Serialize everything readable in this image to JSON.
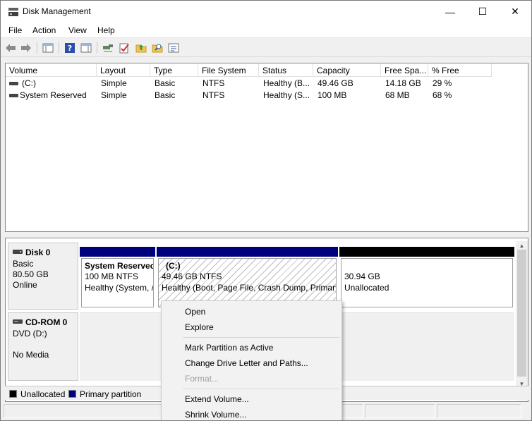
{
  "window": {
    "title": "Disk Management"
  },
  "controls": {
    "minimize": "—",
    "maximize": "☐",
    "close": "✕"
  },
  "menu": [
    "File",
    "Action",
    "View",
    "Help"
  ],
  "volume_list": {
    "columns": [
      "Volume",
      "Layout",
      "Type",
      "File System",
      "Status",
      "Capacity",
      "Free Spa...",
      "% Free"
    ],
    "rows": [
      [
        "(C:)",
        "Simple",
        "Basic",
        "NTFS",
        "Healthy (B...",
        "49.46 GB",
        "14.18 GB",
        "29 %"
      ],
      [
        "System Reserved",
        "Simple",
        "Basic",
        "NTFS",
        "Healthy (S...",
        "100 MB",
        "68 MB",
        "68 %"
      ]
    ]
  },
  "disks": [
    {
      "name": "Disk 0",
      "lines": [
        "Basic",
        "80.50 GB",
        "Online"
      ],
      "partitions": [
        {
          "title": "System Reservec",
          "line1": "100 MB NTFS",
          "line2": "Healthy (System, /"
        },
        {
          "title": "(C:)",
          "line1": "49.46 GB NTFS",
          "line2": "Healthy (Boot, Page File, Crash Dump, Primary"
        },
        {
          "title": "",
          "line1": "30.94 GB",
          "line2": "Unallocated"
        }
      ]
    },
    {
      "name": "CD-ROM 0",
      "lines": [
        "DVD (D:)",
        "",
        "No Media"
      ]
    }
  ],
  "legend": [
    {
      "label": "Unallocated",
      "color": "#000000"
    },
    {
      "label": "Primary partition",
      "color": "#00007f"
    }
  ],
  "colors": {
    "primary_bar": "#00007f",
    "unallocated_bar": "#000000"
  },
  "context_menu": {
    "open": "Open",
    "explore": "Explore",
    "mark_active": "Mark Partition as Active",
    "change_letter": "Change Drive Letter and Paths...",
    "format": "Format...",
    "extend": "Extend Volume...",
    "shrink": "Shrink Volume..."
  }
}
